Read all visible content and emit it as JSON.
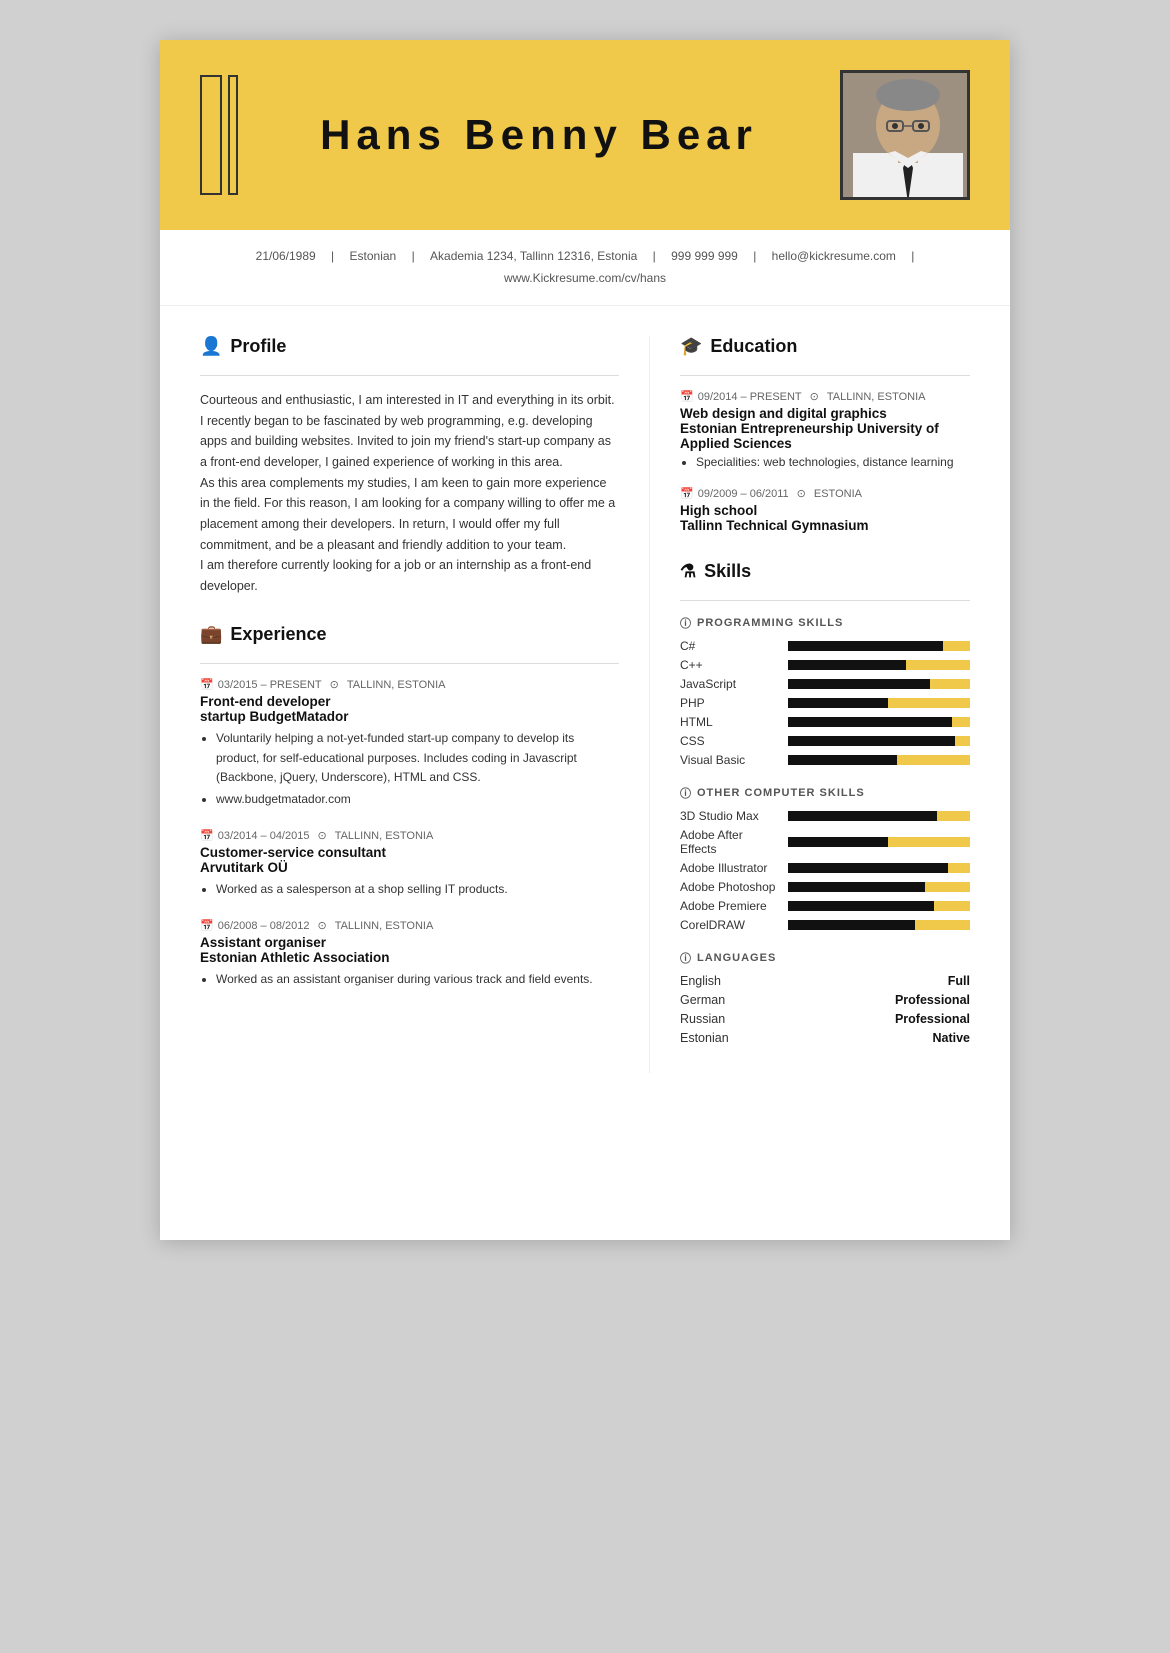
{
  "header": {
    "name": "Hans  Benny  Bear",
    "photo_alt": "Profile photo of Hans Benny Bear"
  },
  "contact": {
    "dob": "21/06/1989",
    "nationality": "Estonian",
    "address": "Akademia 1234, Tallinn 12316, Estonia",
    "phone": "999 999 999",
    "email": "hello@kickresume.com",
    "website": "www.Kickresume.com/cv/hans"
  },
  "sections": {
    "profile_title": "Profile",
    "profile_icon": "👤",
    "profile_text": "Courteous and enthusiastic, I am interested in IT and everything in its orbit. I recently began to be fascinated by web programming, e.g. developing apps and building websites. Invited to join my friend's start-up company as a front-end developer, I gained experience of working in this area.\nAs this area complements my studies, I am keen to gain more experience in the field. For this reason, I am looking for a company willing to offer me a placement among their developers. In return, I would offer my full commitment, and be a pleasant and friendly addition to your team.\nI am therefore currently looking for a job or an internship as a front-end developer.",
    "experience_title": "Experience",
    "experience_icon": "💼",
    "education_title": "Education",
    "education_icon": "🎓",
    "skills_title": "Skills",
    "skills_icon": "⚗"
  },
  "experience": [
    {
      "period": "03/2015 – PRESENT",
      "location": "TALLINN, ESTONIA",
      "title": "Front-end developer",
      "company": "startup BudgetMatador",
      "bullets": [
        "Voluntarily helping a not-yet-funded start-up company to develop its product, for self-educational purposes. Includes coding in Javascript (Backbone, jQuery, Underscore), HTML and CSS.",
        "www.budgetmatador.com"
      ]
    },
    {
      "period": "03/2014 – 04/2015",
      "location": "TALLINN, ESTONIA",
      "title": "Customer-service consultant",
      "company": "Arvutitark OÜ",
      "bullets": [
        "Worked as a salesperson at a shop selling IT products."
      ]
    },
    {
      "period": "06/2008 – 08/2012",
      "location": "TALLINN, ESTONIA",
      "title": "Assistant organiser",
      "company": "Estonian Athletic Association",
      "bullets": [
        "Worked as an assistant organiser during various track and field events."
      ]
    }
  ],
  "education": [
    {
      "period": "09/2014 – PRESENT",
      "location": "TALLINN, ESTONIA",
      "degree": "Web design and digital graphics",
      "school": "Estonian Entrepreneurship University of Applied Sciences",
      "bullets": [
        "Specialities: web technologies, distance learning"
      ]
    },
    {
      "period": "09/2009 – 06/2011",
      "location": "ESTONIA",
      "degree": "High school",
      "school": "Tallinn Technical Gymnasium",
      "bullets": []
    }
  ],
  "skills": {
    "programming": {
      "title": "PROGRAMMING SKILLS",
      "items": [
        {
          "name": "C#",
          "level": 85
        },
        {
          "name": "C++",
          "level": 65
        },
        {
          "name": "JavaScript",
          "level": 78
        },
        {
          "name": "PHP",
          "level": 55
        },
        {
          "name": "HTML",
          "level": 90
        },
        {
          "name": "CSS",
          "level": 92
        },
        {
          "name": "Visual Basic",
          "level": 60
        }
      ]
    },
    "computer": {
      "title": "OTHER COMPUTER SKILLS",
      "items": [
        {
          "name": "3D Studio Max",
          "level": 82
        },
        {
          "name": "Adobe After Effects",
          "level": 55
        },
        {
          "name": "Adobe Illustrator",
          "level": 88
        },
        {
          "name": "Adobe Photoshop",
          "level": 75
        },
        {
          "name": "Adobe Premiere",
          "level": 80
        },
        {
          "name": "CorelDRAW",
          "level": 70
        }
      ]
    },
    "languages": {
      "title": "LANGUAGES",
      "items": [
        {
          "name": "English",
          "level": "Full"
        },
        {
          "name": "German",
          "level": "Professional"
        },
        {
          "name": "Russian",
          "level": "Professional"
        },
        {
          "name": "Estonian",
          "level": "Native"
        }
      ]
    }
  }
}
